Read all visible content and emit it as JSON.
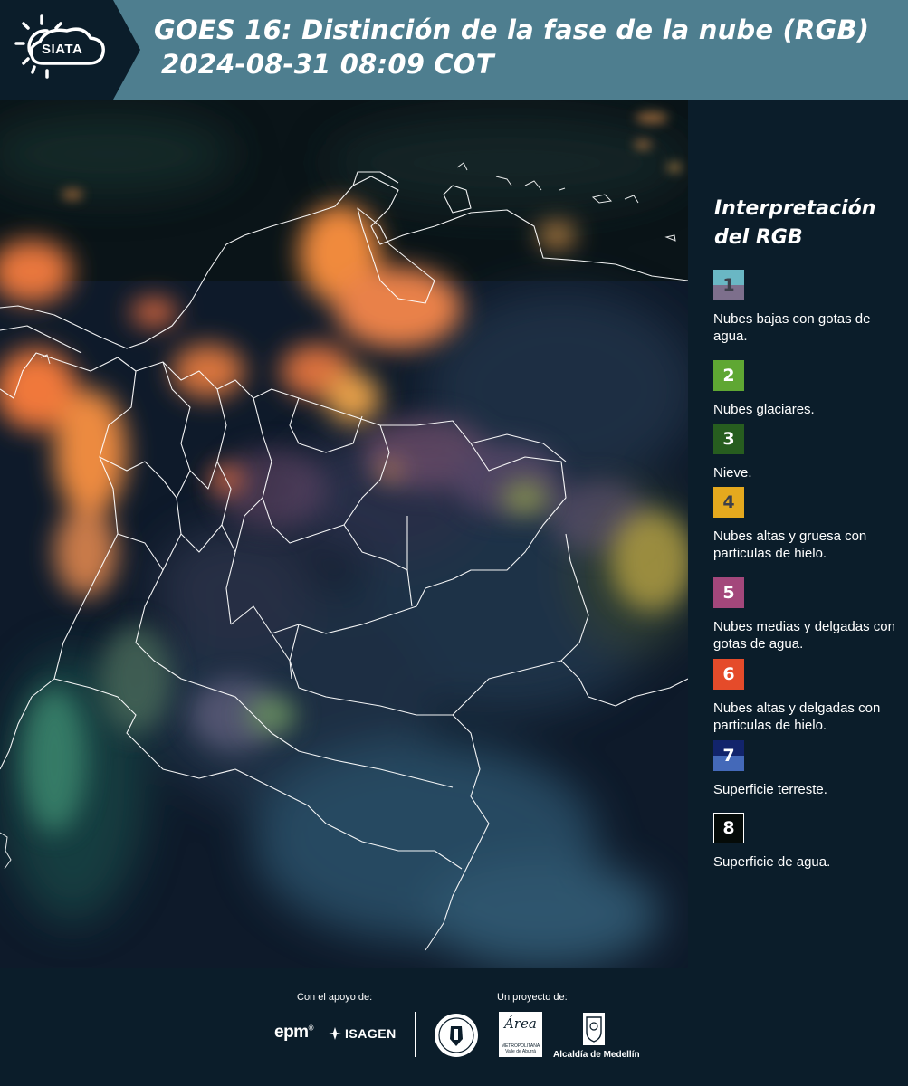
{
  "header": {
    "logo_text": "SIATA",
    "title_line1": "GOES 16: Distinción de la fase de la nube (RGB)",
    "title_line2": "2024-08-31 08:09 COT"
  },
  "legend": {
    "title_line1": "Interpretación",
    "title_line2": "del RGB",
    "items": [
      {
        "number": "1",
        "label": "Nubes bajas con gotas de agua.",
        "color_top": "#6ab7c4",
        "color_bottom": "#7d6f8c",
        "number_color": "#3d3f4a"
      },
      {
        "number": "2",
        "label": "Nubes glaciares.",
        "color": "#5fa733",
        "number_color": "#ffffff"
      },
      {
        "number": "3",
        "label": "Nieve.",
        "color": "#275d1f",
        "number_color": "#ffffff"
      },
      {
        "number": "4",
        "label": "Nubes altas y gruesa con particulas de hielo.",
        "color": "#e5a91e",
        "number_color": "#3d3f4a"
      },
      {
        "number": "5",
        "label": "Nubes medias y delgadas con gotas de agua.",
        "color": "#a3477b",
        "number_color": "#ffffff"
      },
      {
        "number": "6",
        "label": "Nubes altas y delgadas con particulas de hielo.",
        "color": "#e54b2a",
        "number_color": "#ffffff"
      },
      {
        "number": "7",
        "label": "Superficie terreste.",
        "color_top": "#12246b",
        "color_bottom": "#4469b9",
        "number_color": "#ffffff"
      },
      {
        "number": "8",
        "label": "Superficie de agua.",
        "color": "#050b08",
        "border": "#ffffff",
        "number_color": "#ffffff"
      }
    ]
  },
  "footer": {
    "support_label": "Con el apoyo de:",
    "project_label": "Un proyecto de:",
    "epm_text": "epm",
    "epm_mark": "®",
    "isagen_text": "ISAGEN",
    "area_script": "Área",
    "area_small": "METROPOLITANA Valle de Aburrá",
    "alcaldia_text": "Alcaldía de Medellín"
  }
}
